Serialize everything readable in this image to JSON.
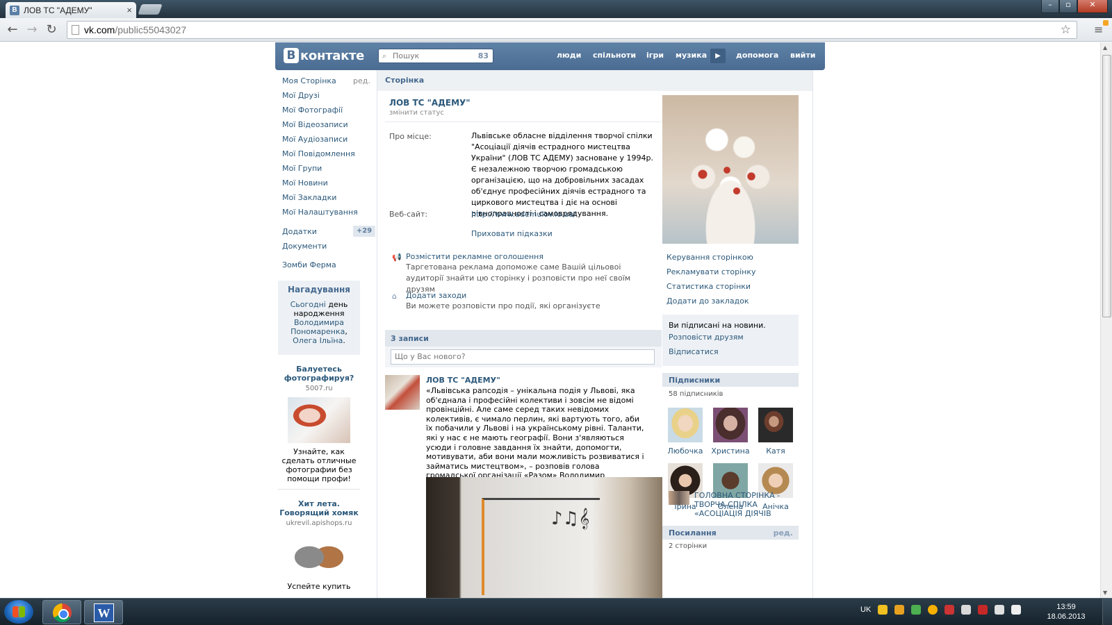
{
  "browser": {
    "tab_title": "ЛОВ ТС \"АДЕМУ\"",
    "tab_favicon": "В",
    "tab_close": "×",
    "url_host": "vk.com",
    "url_path": "/public55043027",
    "back_icon": "←",
    "forward_icon": "→",
    "reload_icon": "↻",
    "star_icon": "☆",
    "menu_icon": "≡"
  },
  "window_controls": {
    "minimize": "–",
    "maximize": "▫",
    "close": "✕"
  },
  "vk_header": {
    "logo_letter": "В",
    "logo_text": "контакте",
    "search_placeholder": "Пошук",
    "search_count": "83",
    "nav": [
      "люди",
      "спільноти",
      "ігри",
      "музика",
      "допомога",
      "вийти"
    ],
    "play_icon": "▶"
  },
  "sidebar": {
    "items": [
      "Моя Сторінка",
      "Мої Друзі",
      "Мої Фотографії",
      "Мої Відеозаписи",
      "Мої Аудіозаписи",
      "Мої Повідомлення",
      "Мої Групи",
      "Мої Новини",
      "Мої Закладки",
      "Мої Налаштування"
    ],
    "edit_label": "ред.",
    "apps_label": "Додатки",
    "apps_count": "+29",
    "docs_label": "Документи",
    "game_label": "Зомби Ферма"
  },
  "reminder": {
    "title": "Нагадування",
    "today": "Сьогодні",
    "text1": "день народження",
    "name1": "Володимира Пономаренка",
    "comma": ",",
    "name2": "Олега Ільїна",
    "period": "."
  },
  "ads": [
    {
      "title": "Балуетесь фотографируя?",
      "domain": "5007.ru",
      "text": "Узнайте, как сделать отличные фотографии без помощи профи!"
    },
    {
      "title": "Хит лета. Говорящий хомяк",
      "domain": "ukrevil.apishops.ru",
      "text": "Успейте купить"
    }
  ],
  "breadcrumb": "Сторінка",
  "page": {
    "title": "ЛОВ ТС \"АДЕМУ\"",
    "change_status": "змінити статус",
    "about_label": "Про місце:",
    "about_text": "Львівське обласне відділення творчої спілки \"Асоціації діячів естрадного мистецтва України\" (ЛОВ ТС АДЕМУ) засноване у 1994р. Є незалежною творчою громадською організацією, що на добровільних засадах об'єднує професійних діячів естрадного та циркового мистецтва і діє на основі рівноправності і самоврядування.",
    "website_label": "Веб-сайт:",
    "website": "http://www.ademulov.io.ua/",
    "hide_hints": "Приховати підказки"
  },
  "promos": [
    {
      "icon": "megaphone-icon",
      "title": "Розмістити рекламне оголошення",
      "desc": "Таргетована реклама допоможе саме Вашій цільовоі аудиторії знайти цю сторінку і розповісти про неї своїм друзям"
    },
    {
      "icon": "house-icon",
      "title": "Додати заходи",
      "desc": "Ви можете розповісти про події, які організуєте"
    }
  ],
  "wall": {
    "header": "3 записи",
    "input_placeholder": "Що у Вас нового?"
  },
  "post": {
    "author": "ЛОВ ТС \"АДЕМУ\"",
    "text": "«Львівська рапсодія – унікальна подія у Львові, яка об'єднала і професійні колективи і зовсім не відомі провінційні. Але саме серед таких невідомих колективів, є чимало перлин, які вартують того, аби їх побачили у Львові і на українському рівні. Таланти, які у нас є не мають географії. Вони з'являються усюди і головне завдання їх знайти, допомогти, мотивувати, аби вони мали можливість розвиватися і займатись мистецтвом», – розповів голова громадської організації «Разом» Володимир Маліновський."
  },
  "right": {
    "links": [
      "Керування сторінкою",
      "Рекламувати сторінку",
      "Статистика сторінки",
      "Додати до закладок"
    ],
    "subscribed": "Ви підписані на новини.",
    "tell_friends": "Розповісти друзям",
    "unsubscribe": "Відписатися",
    "subscribers_title": "Підписники",
    "subscribers_count": "58 підписників",
    "friends": [
      "Любочка",
      "Христина",
      "Катя",
      "Ірина",
      "Олена",
      "Анічка"
    ],
    "links_title": "Посилання",
    "links_edit": "ред.",
    "links_count": "2 сторінки",
    "link_text": "ГОЛОВНА СТОРІНКА - ТВОРЧА СПІЛКА «АСОЦІАЦІЯ ДІЯЧІВ"
  },
  "taskbar": {
    "lang": "UK",
    "time": "13:59",
    "date": "18.06.2013"
  }
}
